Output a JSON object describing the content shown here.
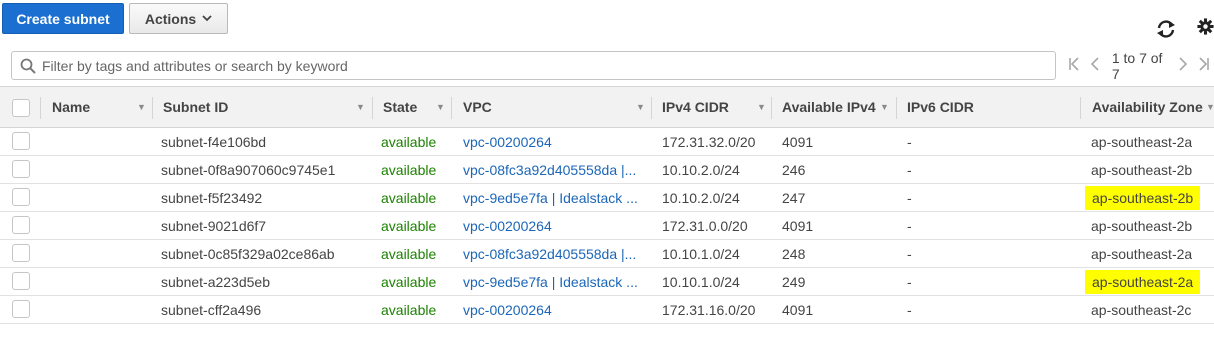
{
  "toolbar": {
    "create_label": "Create subnet",
    "actions_label": "Actions",
    "accent": "#1b6fd0"
  },
  "icons": {
    "refresh": "refresh-icon",
    "settings": "gear-icon",
    "search": "search-icon",
    "first_page": "first-page-icon",
    "prev_page": "prev-page-icon",
    "next_page": "next-page-icon",
    "last_page": "last-page-icon"
  },
  "filter": {
    "placeholder": "Filter by tags and attributes or search by keyword"
  },
  "pagination": {
    "text": "1 to 7 of 7"
  },
  "table": {
    "columns": {
      "name": "Name",
      "subnet_id": "Subnet ID",
      "state": "State",
      "vpc": "VPC",
      "ipv4_cidr": "IPv4 CIDR",
      "available_ipv4": "Available IPv4",
      "ipv6_cidr": "IPv6 CIDR",
      "az": "Availability Zone"
    },
    "rows": [
      {
        "name": "",
        "subnet_id": "subnet-f4e106bd",
        "state": "available",
        "vpc": "vpc-00200264",
        "ipv4_cidr": "172.31.32.0/20",
        "available_ipv4": "4091",
        "ipv6_cidr": "-",
        "az": "ap-southeast-2a",
        "az_highlight": false
      },
      {
        "name": "",
        "subnet_id": "subnet-0f8a907060c9745e1",
        "state": "available",
        "vpc": "vpc-08fc3a92d405558da |...",
        "ipv4_cidr": "10.10.2.0/24",
        "available_ipv4": "246",
        "ipv6_cidr": "-",
        "az": "ap-southeast-2b",
        "az_highlight": false
      },
      {
        "name": "",
        "subnet_id": "subnet-f5f23492",
        "state": "available",
        "vpc": "vpc-9ed5e7fa | Idealstack ...",
        "ipv4_cidr": "10.10.2.0/24",
        "available_ipv4": "247",
        "ipv6_cidr": "-",
        "az": "ap-southeast-2b",
        "az_highlight": true
      },
      {
        "name": "",
        "subnet_id": "subnet-9021d6f7",
        "state": "available",
        "vpc": "vpc-00200264",
        "ipv4_cidr": "172.31.0.0/20",
        "available_ipv4": "4091",
        "ipv6_cidr": "-",
        "az": "ap-southeast-2b",
        "az_highlight": false
      },
      {
        "name": "",
        "subnet_id": "subnet-0c85f329a02ce86ab",
        "state": "available",
        "vpc": "vpc-08fc3a92d405558da |...",
        "ipv4_cidr": "10.10.1.0/24",
        "available_ipv4": "248",
        "ipv6_cidr": "-",
        "az": "ap-southeast-2a",
        "az_highlight": false
      },
      {
        "name": "",
        "subnet_id": "subnet-a223d5eb",
        "state": "available",
        "vpc": "vpc-9ed5e7fa | Idealstack ...",
        "ipv4_cidr": "10.10.1.0/24",
        "available_ipv4": "249",
        "ipv6_cidr": "-",
        "az": "ap-southeast-2a",
        "az_highlight": true
      },
      {
        "name": "",
        "subnet_id": "subnet-cff2a496",
        "state": "available",
        "vpc": "vpc-00200264",
        "ipv4_cidr": "172.31.16.0/20",
        "available_ipv4": "4091",
        "ipv6_cidr": "-",
        "az": "ap-southeast-2c",
        "az_highlight": false
      }
    ]
  },
  "colors": {
    "state_available": "#1d8102",
    "link": "#1c66b8",
    "highlight": "#ffff00"
  }
}
